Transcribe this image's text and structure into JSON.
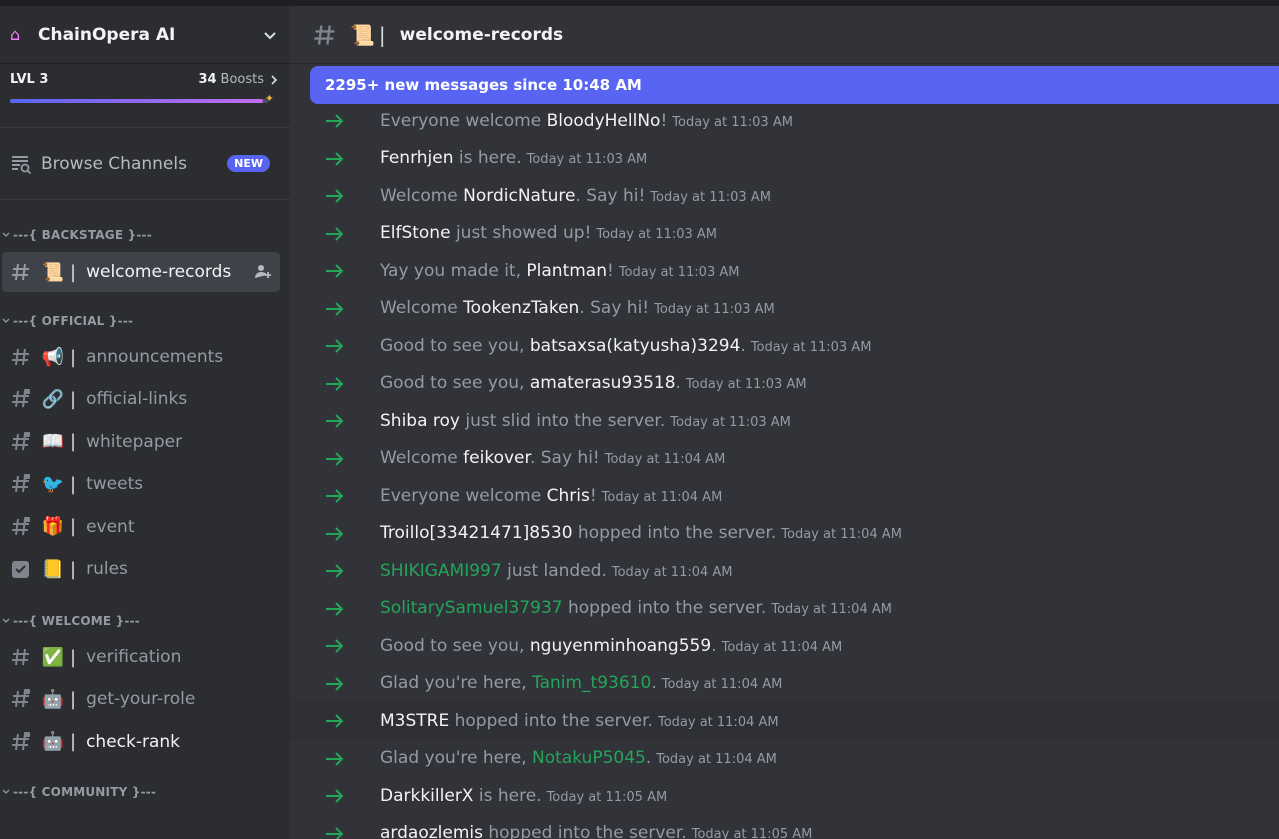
{
  "server": {
    "name": "ChainOpera AI",
    "level": "LVL 3",
    "boost_count": "34",
    "boost_label": "Boosts",
    "level_progress": 0.98
  },
  "browse": {
    "label": "Browse Channels",
    "badge": "NEW"
  },
  "categories": [
    {
      "label": "---{ BACKSTAGE }---"
    },
    {
      "label": "---{ OFFICIAL }---"
    },
    {
      "label": "---{ WELCOME }---"
    },
    {
      "label": "---{ COMMUNITY }---"
    }
  ],
  "channels": [
    {
      "emoji": "📜",
      "name": "welcome-records"
    },
    {
      "emoji": "📢",
      "name": "announcements"
    },
    {
      "emoji": "🔗",
      "name": "official-links"
    },
    {
      "emoji": "📖",
      "name": "whitepaper"
    },
    {
      "emoji": "🐦",
      "name": "tweets"
    },
    {
      "emoji": "🎁",
      "name": "event"
    },
    {
      "emoji": "📒",
      "name": "rules"
    },
    {
      "emoji": "✅",
      "name": "verification"
    },
    {
      "emoji": "🤖",
      "name": "get-your-role"
    },
    {
      "emoji": "🤖",
      "name": "check-rank"
    }
  ],
  "header": {
    "emoji": "📜",
    "channel": "welcome-records"
  },
  "new_messages_bar": "2295+ new messages since 10:48 AM",
  "messages": [
    {
      "pre": "Everyone welcome ",
      "user": "BloodyHellNo",
      "post": "!",
      "time": "Today at 11:03 AM"
    },
    {
      "pre": "",
      "user": "Fenrhjen",
      "post": " is here.",
      "time": "Today at 11:03 AM"
    },
    {
      "pre": "Welcome ",
      "user": "NordicNature",
      "post": ". Say hi!",
      "time": "Today at 11:03 AM"
    },
    {
      "pre": "",
      "user": "ElfStone",
      "post": " just showed up!",
      "time": "Today at 11:03 AM"
    },
    {
      "pre": "Yay you made it, ",
      "user": "Plantman",
      "post": "!",
      "time": "Today at 11:03 AM"
    },
    {
      "pre": "Welcome ",
      "user": "TookenzTaken",
      "post": ". Say hi!",
      "time": "Today at 11:03 AM"
    },
    {
      "pre": "Good to see you, ",
      "user": "batsaxsa(katyusha)3294",
      "post": ".",
      "time": "Today at 11:03 AM"
    },
    {
      "pre": "Good to see you, ",
      "user": "amaterasu93518",
      "post": ".",
      "time": "Today at 11:03 AM"
    },
    {
      "pre": "",
      "user": "Shiba roy",
      "post": " just slid into the server.",
      "time": "Today at 11:03 AM"
    },
    {
      "pre": "Welcome ",
      "user": "feikover",
      "post": ". Say hi!",
      "time": "Today at 11:04 AM"
    },
    {
      "pre": "Everyone welcome ",
      "user": "Chris",
      "post": "!",
      "time": "Today at 11:04 AM"
    },
    {
      "pre": "",
      "user": "Troillo[33421471]8530",
      "post": " hopped into the server.",
      "time": "Today at 11:04 AM"
    },
    {
      "pre": "",
      "user": "SHIKIGAMI997",
      "post": " just landed.",
      "time": "Today at 11:04 AM"
    },
    {
      "pre": "",
      "user": "SolitarySamuel37937",
      "post": " hopped into the server.",
      "time": "Today at 11:04 AM"
    },
    {
      "pre": "Good to see you, ",
      "user": "nguyenminhoang559",
      "post": ".",
      "time": "Today at 11:04 AM"
    },
    {
      "pre": "Glad you're here, ",
      "user": "Tanim_t93610",
      "post": ".",
      "time": "Today at 11:04 AM"
    },
    {
      "pre": "",
      "user": "M3STRE",
      "post": " hopped into the server.",
      "time": "Today at 11:04 AM"
    },
    {
      "pre": "Glad you're here, ",
      "user": "NotakuP5045",
      "post": ".",
      "time": "Today at 11:04 AM"
    },
    {
      "pre": "",
      "user": "DarkkillerX",
      "post": " is here.",
      "time": "Today at 11:05 AM"
    },
    {
      "pre": "",
      "user": "ardaozlemis",
      "post": " hopped into the server.",
      "time": "Today at 11:05 AM"
    }
  ],
  "colors": {
    "accent": "#5865f2",
    "green_user": "#23a55a",
    "arrow": "#23a55a"
  }
}
